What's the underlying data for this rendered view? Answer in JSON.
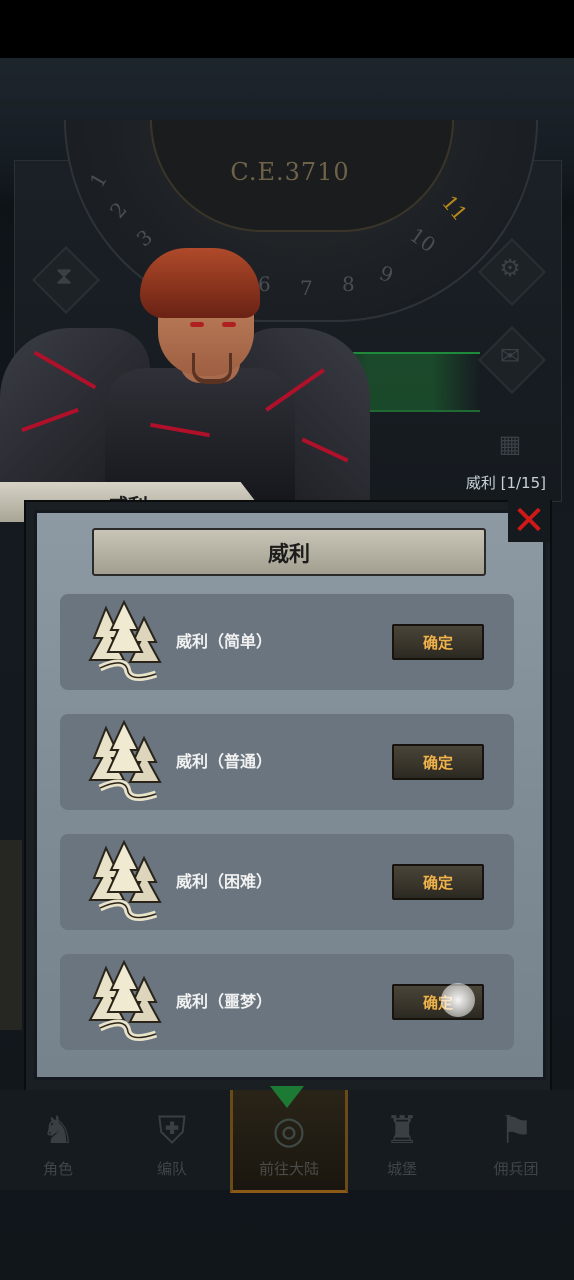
{
  "hud": {
    "era": "C.E.3710",
    "dial_numbers": [
      "1",
      "2",
      "3",
      "6",
      "7",
      "8",
      "9",
      "10",
      "11"
    ],
    "highlighted_number": "11",
    "stage_counter": "威利 [1/15]"
  },
  "hero": {
    "name": "威利"
  },
  "dialog": {
    "title": "威利",
    "close_label": "✕",
    "options": [
      {
        "label": "威利（简单）",
        "button": "确定",
        "icon": "forest-icon"
      },
      {
        "label": "威利（普通）",
        "button": "确定",
        "icon": "forest-icon"
      },
      {
        "label": "威利（困难）",
        "button": "确定",
        "icon": "forest-icon"
      },
      {
        "label": "威利（噩梦）",
        "button": "确定",
        "icon": "forest-icon"
      }
    ]
  },
  "bottom_nav": {
    "items": [
      {
        "label": "角色",
        "icon": "knight-icon"
      },
      {
        "label": "编队",
        "icon": "helmet-icon"
      },
      {
        "label": "前往大陆",
        "icon": "world-icon",
        "active": true
      },
      {
        "label": "城堡",
        "icon": "castle-icon"
      },
      {
        "label": "佣兵团",
        "icon": "banner-icon"
      }
    ]
  },
  "colors": {
    "accent_red": "#d01818",
    "button_text": "#f0b24a",
    "dialog_bg": "#838f99",
    "active_nav": "#8a5a16"
  }
}
